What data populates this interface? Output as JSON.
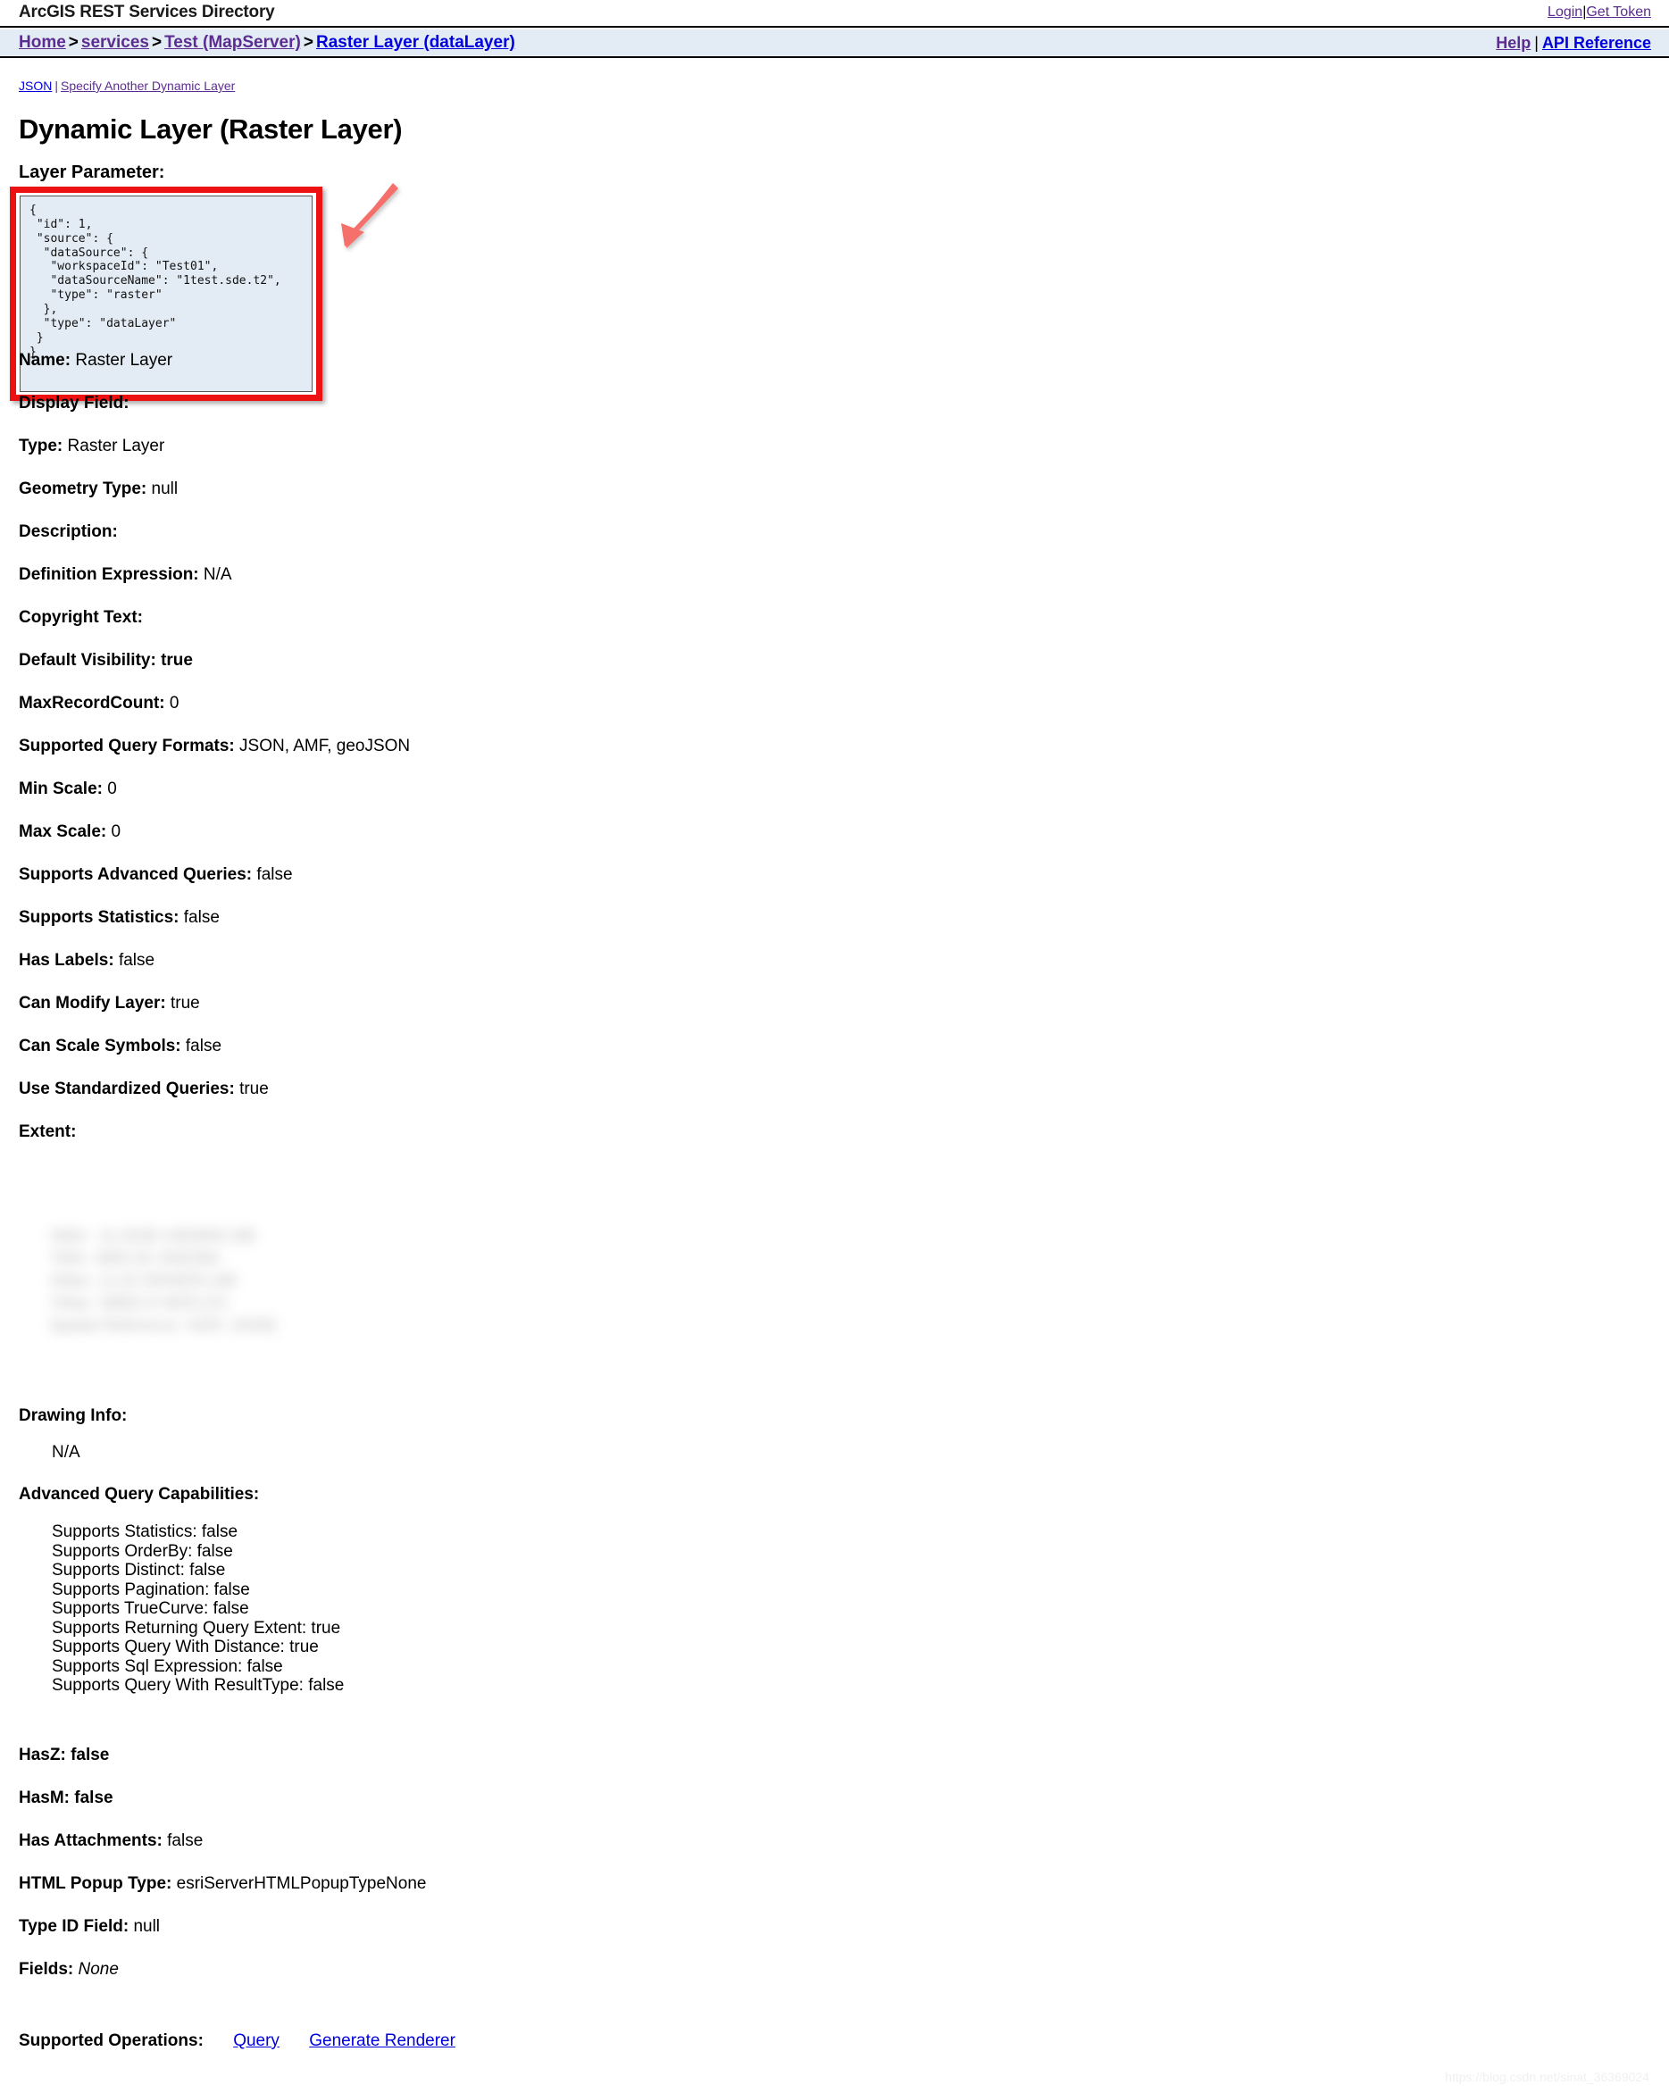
{
  "header": {
    "app_title": "ArcGIS REST Services Directory",
    "login_label": "Login",
    "get_token_label": "Get Token",
    "separator": "|",
    "help_label": "Help",
    "api_reference_label": "API Reference"
  },
  "breadcrumb": {
    "home": "Home",
    "services": "services",
    "service": "Test (MapServer)",
    "layer": "Raster Layer (dataLayer)",
    "sep": ">"
  },
  "sublinks": {
    "json": "JSON",
    "specify": "Specify Another Dynamic Layer",
    "pipe": "|"
  },
  "page": {
    "title": "Dynamic Layer (Raster Layer)",
    "layer_parameter_label": "Layer Parameter:",
    "layer_parameter_value": "{\n \"id\": 1,\n \"source\": {\n  \"dataSource\": {\n   \"workspaceId\": \"Test01\",\n   \"dataSourceName\": \"1test.sde.t2\",\n   \"type\": \"raster\"\n  },\n  \"type\": \"dataLayer\"\n }\n}"
  },
  "properties": [
    {
      "label": "Name:",
      "value": "Raster Layer"
    },
    {
      "label": "Display Field:",
      "value": ""
    },
    {
      "label": "Type:",
      "value": "Raster Layer"
    },
    {
      "label": "Geometry Type:",
      "value": "null"
    },
    {
      "label": "Description:",
      "value": ""
    },
    {
      "label": "Definition Expression:",
      "value": "N/A"
    },
    {
      "label": "Copyright Text:",
      "value": ""
    },
    {
      "label": "Default Visibility: true",
      "value": ""
    },
    {
      "label": "MaxRecordCount:",
      "value": "0"
    },
    {
      "label": "Supported Query Formats:",
      "value": "JSON, AMF, geoJSON"
    },
    {
      "label": "Min Scale:",
      "value": "0"
    },
    {
      "label": "Max Scale:",
      "value": "0"
    },
    {
      "label": "Supports Advanced Queries:",
      "value": "false"
    },
    {
      "label": "Supports Statistics:",
      "value": "false"
    },
    {
      "label": "Has Labels:",
      "value": "false"
    },
    {
      "label": "Can Modify Layer:",
      "value": "true"
    },
    {
      "label": "Can Scale Symbols:",
      "value": "false"
    },
    {
      "label": "Use Standardized Queries:",
      "value": "true"
    }
  ],
  "extent": {
    "label": "Extent:",
    "redacted": true,
    "placeholder_lines": "XMin: -11.0238 1482859.188\nYMin: 4882.92 3492384\nXMax: 11.02 9204829.188\nYMax: 48802.9 4829.221\nSpatial Reference: 4326  (4326)"
  },
  "drawing_info": {
    "label": "Drawing Info:",
    "value": "N/A"
  },
  "advanced_query_capabilities": {
    "label": "Advanced Query Capabilities:",
    "items": [
      "Supports Statistics: false",
      "Supports OrderBy: false",
      "Supports Distinct: false",
      "Supports Pagination: false",
      "Supports TrueCurve: false",
      "Supports Returning Query Extent: true",
      "Supports Query With Distance: true",
      "Supports Sql Expression: false",
      "Supports Query With ResultType: false"
    ]
  },
  "properties_tail": [
    {
      "label": "HasZ: false",
      "value": ""
    },
    {
      "label": "HasM: false",
      "value": ""
    },
    {
      "label": "Has Attachments:",
      "value": "false"
    },
    {
      "label": "HTML Popup Type:",
      "value": "esriServerHTMLPopupTypeNone"
    },
    {
      "label": "Type ID Field:",
      "value": "null"
    },
    {
      "label": "Fields:",
      "value": "None",
      "italic": true
    }
  ],
  "supported_operations": {
    "label": "Supported Operations:",
    "query_label": "Query",
    "generate_renderer_label": "Generate Renderer"
  },
  "watermark": "https://blog.csdn.net/sinat_36369024",
  "colors": {
    "bar_background": "#e3ecf5",
    "visited_link": "#5c2d91",
    "link": "#0000dd",
    "annotation_red": "#ee1111",
    "annotation_arrow": "#f5706a",
    "textarea_background": "#e3ecf5"
  }
}
